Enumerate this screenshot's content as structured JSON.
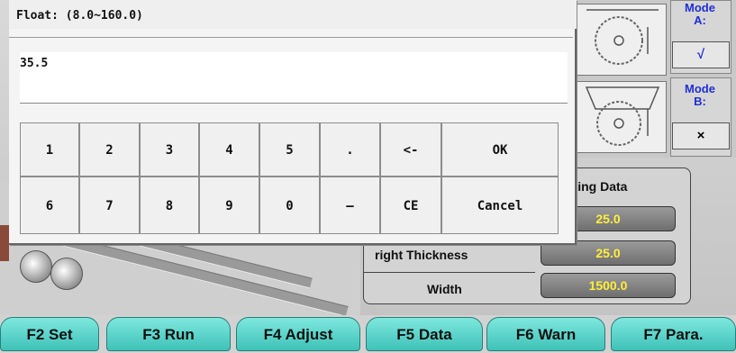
{
  "dialog": {
    "title": "Float: (8.0~160.0)",
    "value": "35.5",
    "keys_row1": [
      "1",
      "2",
      "3",
      "4",
      "5",
      ".",
      "<-"
    ],
    "keys_row2": [
      "6",
      "7",
      "8",
      "9",
      "0",
      "–",
      "CE"
    ],
    "ok_label": "OK",
    "cancel_label": "Cancel"
  },
  "mode_panel": {
    "mode_a_label": "Mode\nA:",
    "mode_a_value": "√",
    "mode_b_label": "Mode\nB:",
    "mode_b_value": "×"
  },
  "working_data": {
    "title": "rking Data",
    "row1_value": "25.0",
    "row2_label": "right Thickness",
    "row2_value": "25.0",
    "row3_label": "Width",
    "row3_value": "1500.0"
  },
  "function_keys": [
    {
      "label": "F2  Set"
    },
    {
      "label": "F3  Run"
    },
    {
      "label": "F4 Adjust"
    },
    {
      "label": "F5 Data"
    },
    {
      "label": "F6 Warn"
    },
    {
      "label": "F7 Para."
    }
  ],
  "colors": {
    "accent_teal": "#4fd0c6",
    "value_yellow": "#ffef3a",
    "mode_blue": "#1e2fd6"
  }
}
